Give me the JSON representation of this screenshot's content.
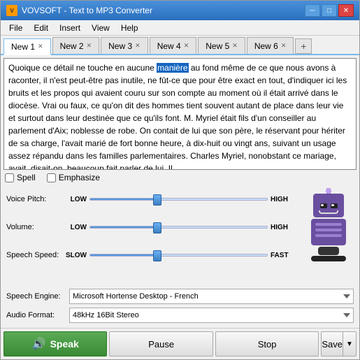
{
  "window": {
    "title": "VOVSOFT - Text to MP3 Converter",
    "icon_label": "V"
  },
  "menu": {
    "items": [
      "File",
      "Edit",
      "Insert",
      "View",
      "Help"
    ]
  },
  "tabs": [
    {
      "label": "New 1",
      "active": true
    },
    {
      "label": "New 2",
      "active": false
    },
    {
      "label": "New 3",
      "active": false
    },
    {
      "label": "New 4",
      "active": false
    },
    {
      "label": "New 5",
      "active": false
    },
    {
      "label": "New 6",
      "active": false
    }
  ],
  "editor": {
    "text_before_highlight": "Quoique ce détail ne touche en aucune ",
    "highlight_word": "manière",
    "text_after_highlight": " au fond même de ce que nous avons à raconter, il n'est peut-être pas inutile, ne fût-ce que pour être exact en tout, d'indiquer ici les bruits et les propos qui avaient couru sur son compte au moment où il était arrivé dans le diocèse.",
    "text_rest": " Vrai ou faux, ce qu'on dit des hommes tient souvent autant de place dans leur vie et surtout dans leur destinée que ce qu'ils font. M. Myriel était fils d'un conseiller au parlement d'Aix; noblesse de robe. On contait de lui que son père, le réservant pour hériter de sa charge, l'avait marié de fort bonne heure, à dix-huit ou vingt ans, suivant un usage assez répandu dans les familles parlementaires. Charles Myriel, nonobstant ce mariage, avait, disait-on, beaucoup fait parler de lui. Il"
  },
  "checkboxes": {
    "spell_label": "Spell",
    "emphasize_label": "Emphasize"
  },
  "voice_pitch": {
    "label": "Voice Pitch:",
    "low_label": "LOW",
    "high_label": "HIGH",
    "value_percent": 38
  },
  "volume": {
    "label": "Volume:",
    "low_label": "LOW",
    "high_label": "HIGH",
    "value_percent": 38
  },
  "speech_speed": {
    "label": "Speech Speed:",
    "low_label": "SLOW",
    "high_label": "FAST",
    "value_percent": 38
  },
  "speech_engine": {
    "label": "Speech Engine:",
    "value": "Microsoft Hortense Desktop - French",
    "options": [
      "Microsoft Hortense Desktop - French"
    ]
  },
  "audio_format": {
    "label": "Audio Format:",
    "value": "48kHz 16Bit Stereo",
    "options": [
      "48kHz 16Bit Stereo"
    ]
  },
  "buttons": {
    "speak": "Speak",
    "pause": "Pause",
    "stop": "Stop",
    "save": "Save"
  }
}
